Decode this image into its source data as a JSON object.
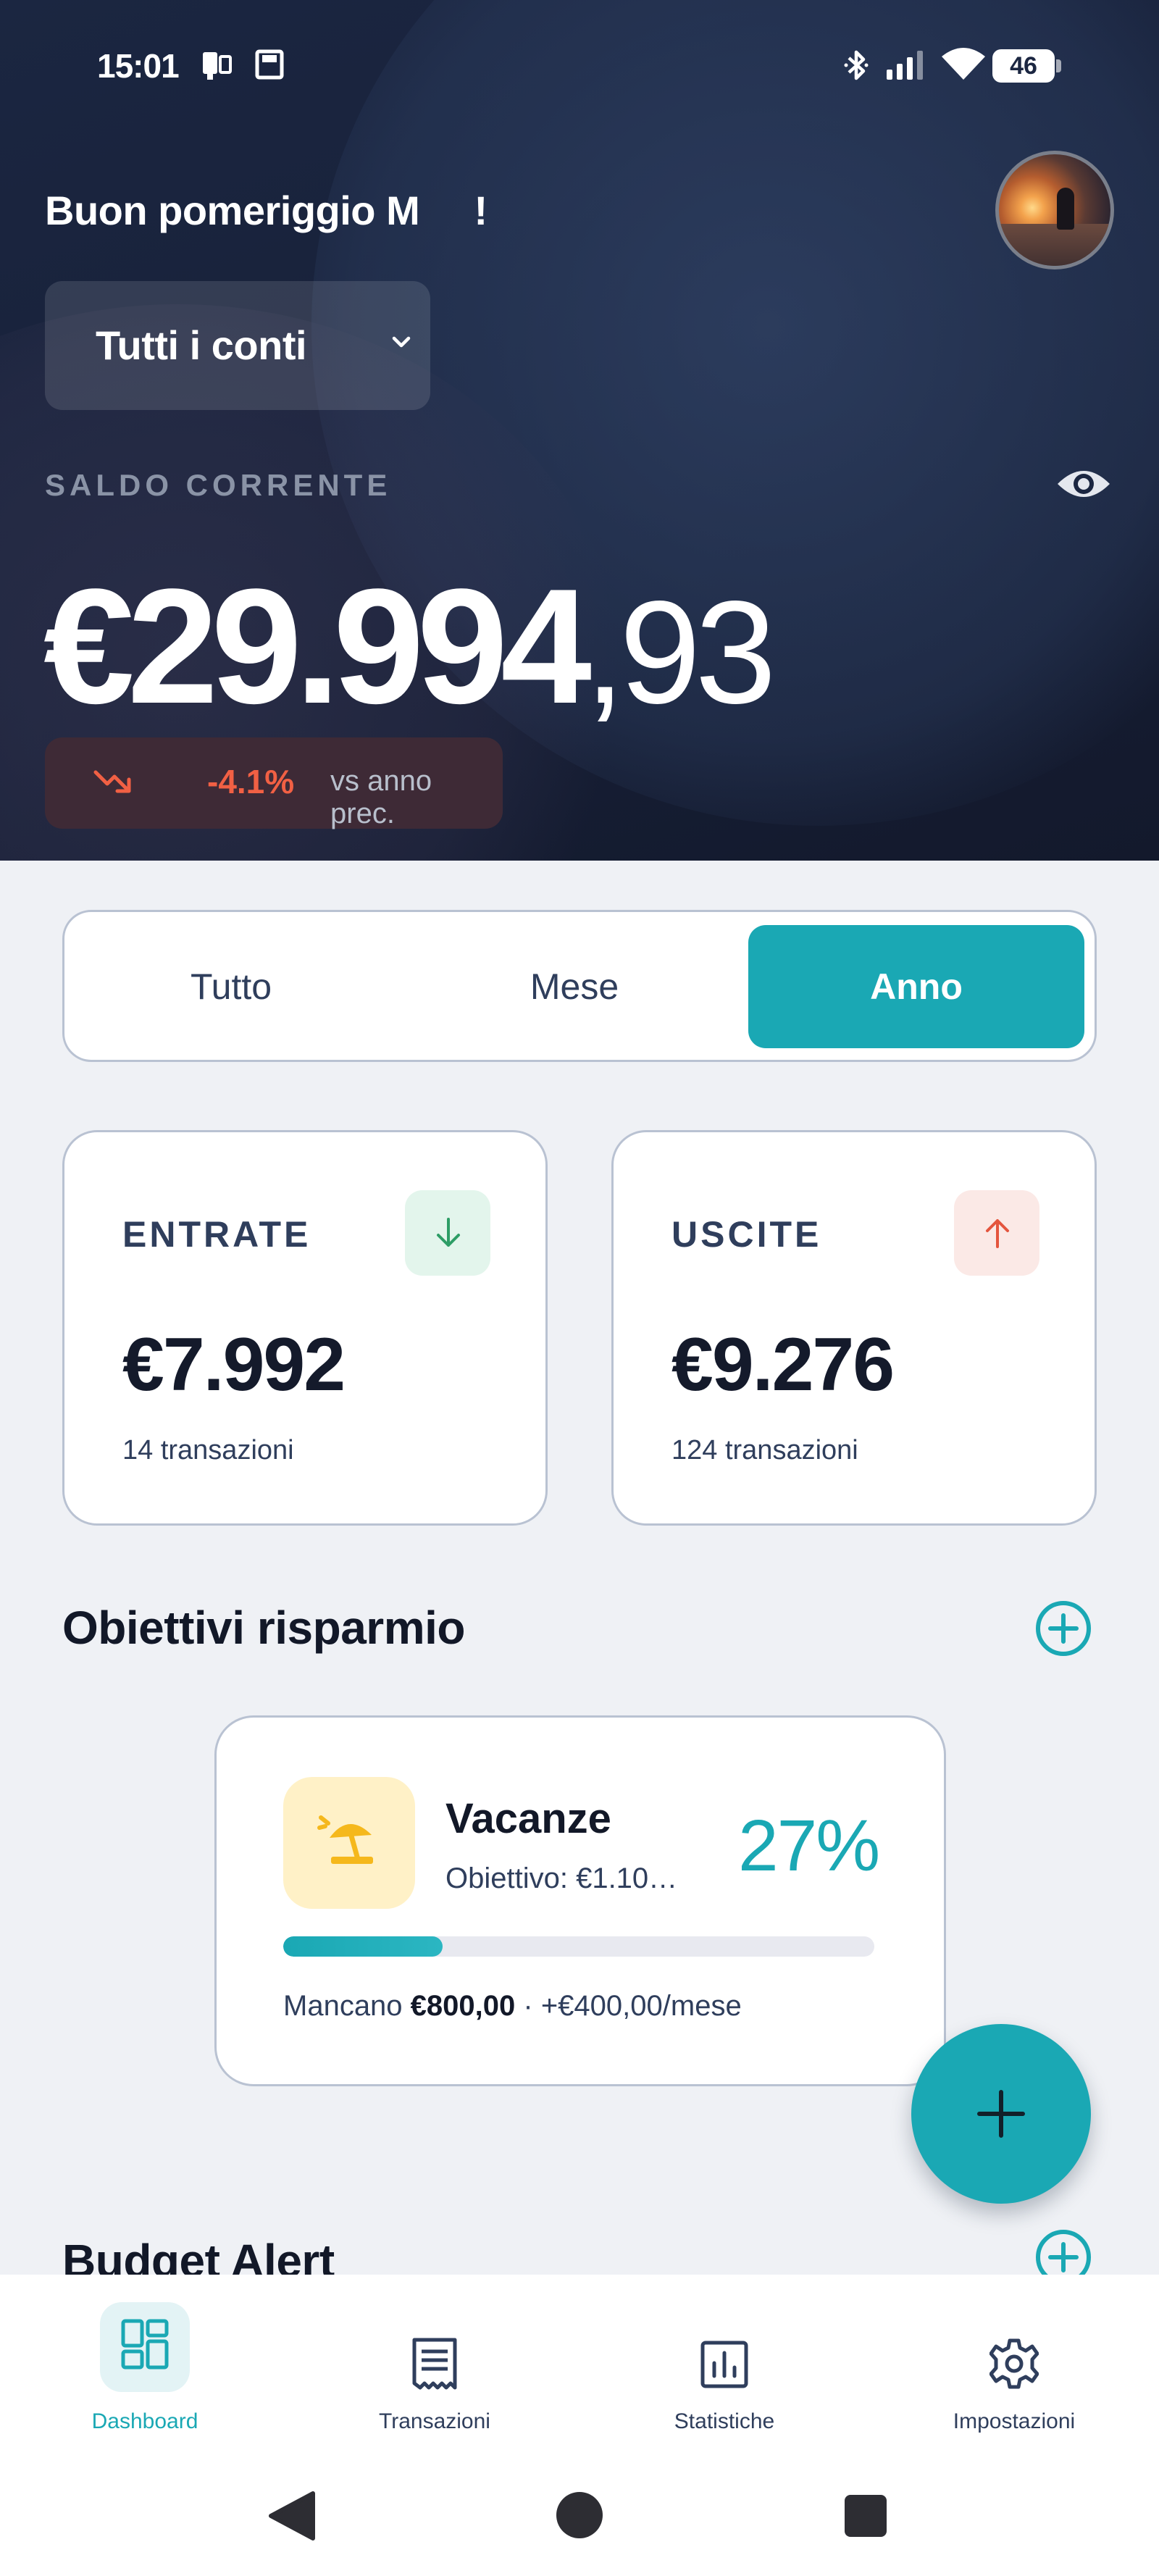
{
  "status_bar": {
    "time": "15:01",
    "battery_level": "46",
    "icons": [
      "sim-card-icon",
      "sd-card-icon",
      "bluetooth-icon",
      "signal-icon",
      "wifi-icon",
      "battery-icon"
    ]
  },
  "header": {
    "greeting": "Buon pomeriggio M     !",
    "account_selector": "Tutti i conti",
    "balance_label": "SALDO CORRENTE",
    "balance_integer": "€29.994",
    "balance_decimal": ",93",
    "trend_percent": "-4.1%",
    "trend_label": "vs anno prec.",
    "colors": {
      "trend_negative": "#f16044",
      "accent": "#1aa8b4"
    }
  },
  "period_tabs": {
    "items": [
      {
        "label": "Tutto",
        "active": false
      },
      {
        "label": "Mese",
        "active": false
      },
      {
        "label": "Anno",
        "active": true
      }
    ]
  },
  "summary": {
    "income": {
      "title": "ENTRATE",
      "amount": "€7.992",
      "count": "14 transazioni",
      "icon": "arrow-down-icon"
    },
    "expenses": {
      "title": "USCITE",
      "amount": "€9.276",
      "count": "124 transazioni",
      "icon": "arrow-up-icon"
    }
  },
  "savings_goals": {
    "title": "Obiettivi risparmio",
    "goals": [
      {
        "name": "Vacanze",
        "target": "Obiettivo: €1.10…",
        "percent_label": "27%",
        "progress": 0.27,
        "remaining_prefix": "Mancano ",
        "remaining_amount": "€800,00",
        "monthly": " · +€400,00/mese",
        "icon": "beach-umbrella-icon"
      }
    ]
  },
  "budget_alert": {
    "title": "Budget Alert"
  },
  "bottom_nav": {
    "items": [
      {
        "label": "Dashboard",
        "icon": "dashboard-icon",
        "active": true
      },
      {
        "label": "Transazioni",
        "icon": "transactions-icon",
        "active": false
      },
      {
        "label": "Statistiche",
        "icon": "statistics-icon",
        "active": false
      },
      {
        "label": "Impostazioni",
        "icon": "settings-icon",
        "active": false
      }
    ]
  }
}
